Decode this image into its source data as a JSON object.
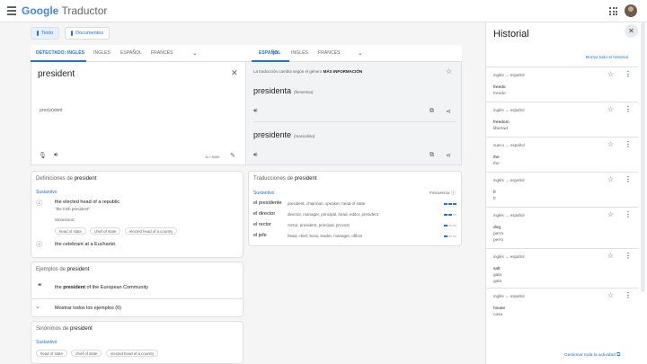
{
  "header": {
    "brand_google": "Google",
    "brand_product": "Traductor"
  },
  "modes": {
    "text": "Texto",
    "documents": "Documentos"
  },
  "source_langs": [
    "DETECTADO: INGLÉS",
    "INGLÉS",
    "ESPAÑOL",
    "FRANCÉS"
  ],
  "target_langs": [
    "ESPAÑOL",
    "INGLÉS",
    "FRANCÉS"
  ],
  "source": {
    "text": "president",
    "phonetic": "prez(ə)dənt",
    "char_count": "11 / 5000"
  },
  "target": {
    "gender_note": "La traducción cambia según el género",
    "more_info": "MÁS INFORMACIÓN",
    "results": [
      {
        "word": "presidenta",
        "gender": "(femenino)"
      },
      {
        "word": "presidente",
        "gender": "(masculino)"
      }
    ]
  },
  "definitions": {
    "title_prefix": "Definiciones de",
    "word": "president",
    "pos": "Sustantivo",
    "items": [
      {
        "num": "1",
        "text": "the elected head of a republic",
        "example": "\"the Irish president\""
      },
      {
        "num": "2",
        "text": "the celebrant at a Eucharist.",
        "example": ""
      }
    ],
    "synonyms_label": "Sinónimos:",
    "synonyms": [
      "head of state",
      "chief of state",
      "elected head of a country"
    ]
  },
  "examples": {
    "title_prefix": "Ejemplos de",
    "word": "president",
    "quote_mark": "❝",
    "sentence_pre": "the",
    "sentence_bold": "president",
    "sentence_post": "of the European Community",
    "show_all": "Mostrar todos los ejemplos (6)"
  },
  "synonyms_section": {
    "title_prefix": "Sinónimos de",
    "word": "president",
    "pos": "Sustantivo",
    "chips": [
      "head of state",
      "chief of state",
      "elected head of a country"
    ]
  },
  "translations": {
    "title_prefix": "Traducciones de",
    "word": "president",
    "pos": "Sustantivo",
    "frequency_label": "Frecuencia",
    "rows": [
      {
        "article": "el",
        "word": "presidente",
        "synonyms": "president, chairman, speaker, head of state",
        "freq": 3
      },
      {
        "article": "el",
        "word": "director",
        "synonyms": "director, manager, principal, head, editor, president",
        "freq": 2
      },
      {
        "article": "el",
        "word": "rector",
        "synonyms": "rector, president, principal, provost",
        "freq": 1
      },
      {
        "article": "el",
        "word": "jefe",
        "synonyms": "head, chief, boss, leader, manager, officer",
        "freq": 1
      }
    ]
  },
  "history": {
    "title": "Historial",
    "clear_all": "Borrar todo el historial",
    "manage": "Gestionar toda la actividad",
    "items": [
      {
        "langs": "inglés → español",
        "lines": [
          "freedo",
          "freedo"
        ]
      },
      {
        "langs": "inglés → español",
        "lines": [
          "freedom",
          "libertad"
        ]
      },
      {
        "langs": "sueco → español",
        "lines": [
          "the",
          "the"
        ]
      },
      {
        "langs": "inglés → español",
        "lines": [
          "fr",
          "fr"
        ]
      },
      {
        "langs": "inglés → español",
        "lines": [
          "dog",
          "perra",
          "perro"
        ]
      },
      {
        "langs": "inglés → español",
        "lines": [
          "salt",
          "gala",
          "gala"
        ]
      },
      {
        "langs": "inglés → español",
        "lines": [
          "house",
          "casa"
        ]
      }
    ]
  }
}
